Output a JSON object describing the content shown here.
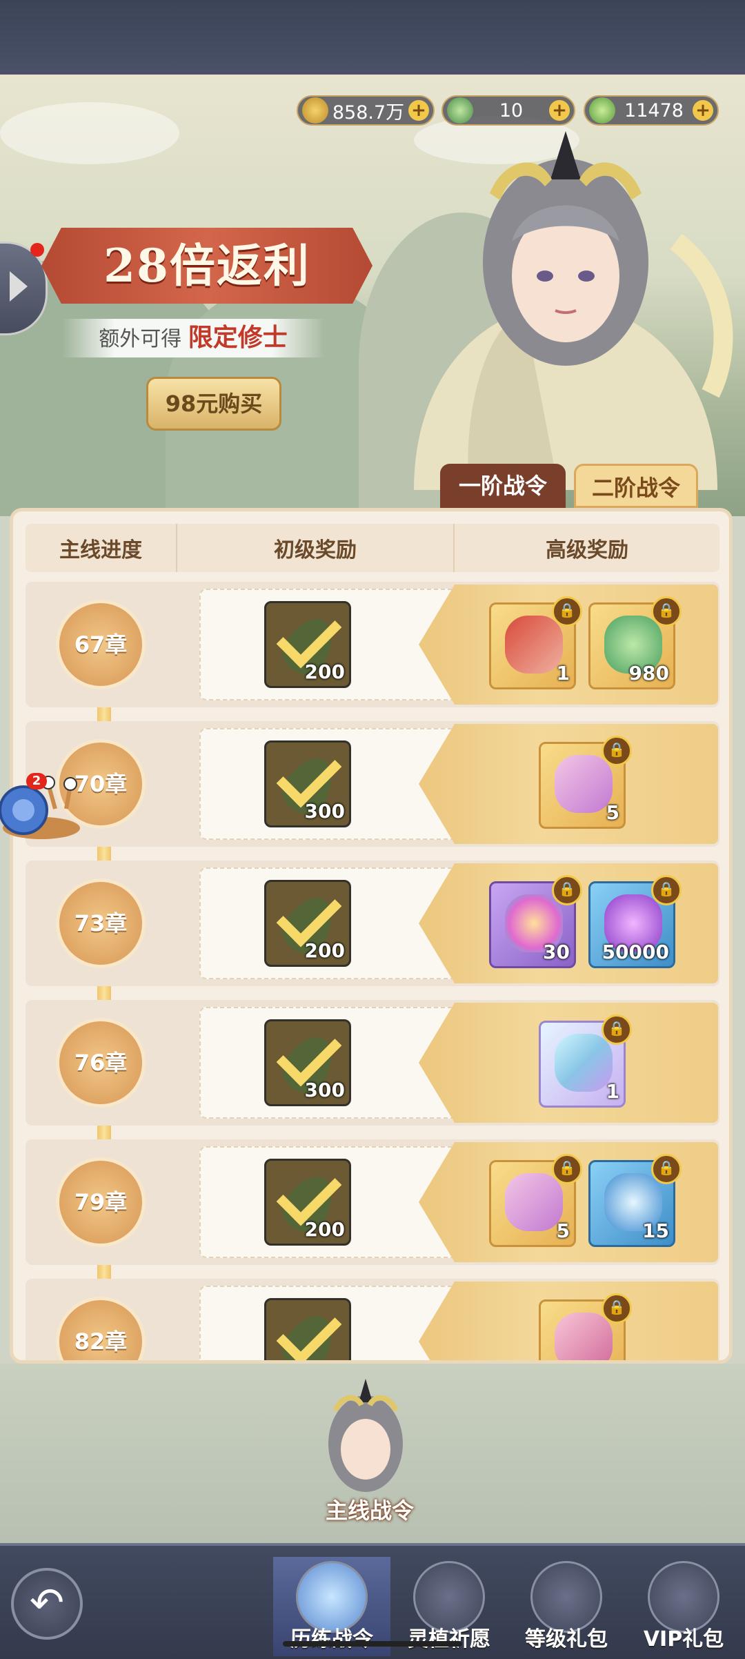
{
  "resources": [
    {
      "name": "coin",
      "value": "858.7万"
    },
    {
      "name": "jade-beast",
      "value": "10"
    },
    {
      "name": "leaf",
      "value": "11478"
    }
  ],
  "promo": {
    "title": "28倍返利",
    "subtitle_prefix": "额外可得",
    "subtitle_highlight": "限定修士",
    "buy_button": "98元购买"
  },
  "tabs": {
    "tier1": "一阶战令",
    "tier2": "二阶战令"
  },
  "table_headers": {
    "progress": "主线进度",
    "basic": "初级奖励",
    "premium": "高级奖励"
  },
  "rows": [
    {
      "chapter": "67章",
      "basic_qty": "200",
      "premium": [
        {
          "icon": "cultivator-chest-icon",
          "qty": "1"
        },
        {
          "icon": "green-leaf-icon",
          "qty": "980"
        }
      ]
    },
    {
      "chapter": "70章",
      "basic_qty": "300",
      "premium": [
        {
          "icon": "pink-scroll-icon",
          "qty": "5"
        }
      ]
    },
    {
      "chapter": "73章",
      "basic_qty": "200",
      "premium": [
        {
          "icon": "rainbow-flame-icon",
          "qty": "30"
        },
        {
          "icon": "purple-flame-icon",
          "qty": "50000"
        }
      ]
    },
    {
      "chapter": "76章",
      "basic_qty": "300",
      "premium": [
        {
          "icon": "crystal-gem-icon",
          "qty": "1"
        }
      ]
    },
    {
      "chapter": "79章",
      "basic_qty": "200",
      "premium": [
        {
          "icon": "pink-scroll-icon",
          "qty": "5"
        },
        {
          "icon": "blue-spirit-icon",
          "qty": "15"
        }
      ]
    },
    {
      "chapter": "82章",
      "basic_qty": "",
      "premium": [
        {
          "icon": "pink-crystal-icon",
          "qty": ""
        }
      ]
    }
  ],
  "snail_badge": "2",
  "mini_label": "主线战令",
  "nav": [
    {
      "label": "历练战令",
      "icon": "pass-icon",
      "active": true
    },
    {
      "label": "灵植祈愿",
      "icon": "plant-wish-icon",
      "active": false
    },
    {
      "label": "等级礼包",
      "icon": "level-gift-icon",
      "active": false
    },
    {
      "label": "VIP礼包",
      "icon": "vip-gift-icon",
      "active": false
    }
  ]
}
